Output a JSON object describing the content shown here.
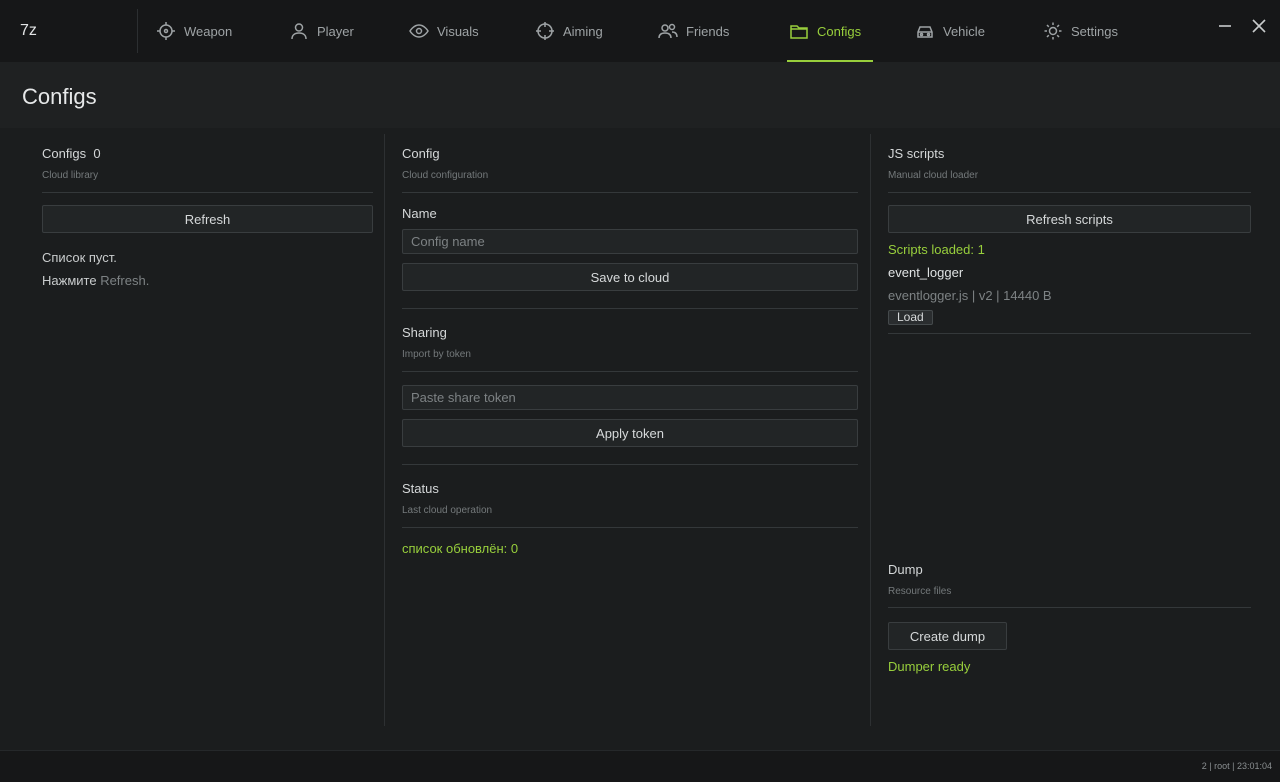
{
  "app": {
    "logo": "7z"
  },
  "nav": {
    "items": [
      {
        "label": "Weapon",
        "icon": "crosshair-icon"
      },
      {
        "label": "Player",
        "icon": "user-icon"
      },
      {
        "label": "Visuals",
        "icon": "eye-icon"
      },
      {
        "label": "Aiming",
        "icon": "target-icon"
      },
      {
        "label": "Friends",
        "icon": "users-icon"
      },
      {
        "label": "Configs",
        "icon": "folder-icon",
        "active": true
      },
      {
        "label": "Vehicle",
        "icon": "car-icon"
      },
      {
        "label": "Settings",
        "icon": "gear-icon"
      }
    ],
    "accent": "#98cf3c"
  },
  "page": {
    "title": "Configs"
  },
  "left": {
    "title": "Configs",
    "count": "0",
    "subtitle": "Cloud library",
    "refresh_label": "Refresh",
    "empty_text": "Список пуст.",
    "hint_strong": "Нажмите",
    "hint_rest": "Refresh."
  },
  "middle": {
    "config": {
      "title": "Config",
      "subtitle": "Cloud configuration"
    },
    "name_label": "Name",
    "name_placeholder": "Config name",
    "save_label": "Save to cloud",
    "sharing": {
      "title": "Sharing",
      "subtitle": "Import by token"
    },
    "token_placeholder": "Paste share token",
    "apply_label": "Apply token",
    "status": {
      "title": "Status",
      "subtitle": "Last cloud operation"
    },
    "status_strong": "список обновлён",
    "status_rest": ": 0"
  },
  "right": {
    "js": {
      "title": "JS scripts",
      "subtitle": "Manual cloud loader"
    },
    "refresh_scripts_label": "Refresh scripts",
    "scripts_loaded": "Scripts loaded: 1",
    "script_name": "event_logger",
    "script_meta": "eventlogger.js | v2 | 14440 B",
    "load_label": "Load",
    "dump": {
      "title": "Dump",
      "subtitle": "Resource files"
    },
    "create_dump_label": "Create dump",
    "dump_status": "Dumper ready"
  },
  "footer": {
    "text": "2 | root | 23:01:04"
  }
}
